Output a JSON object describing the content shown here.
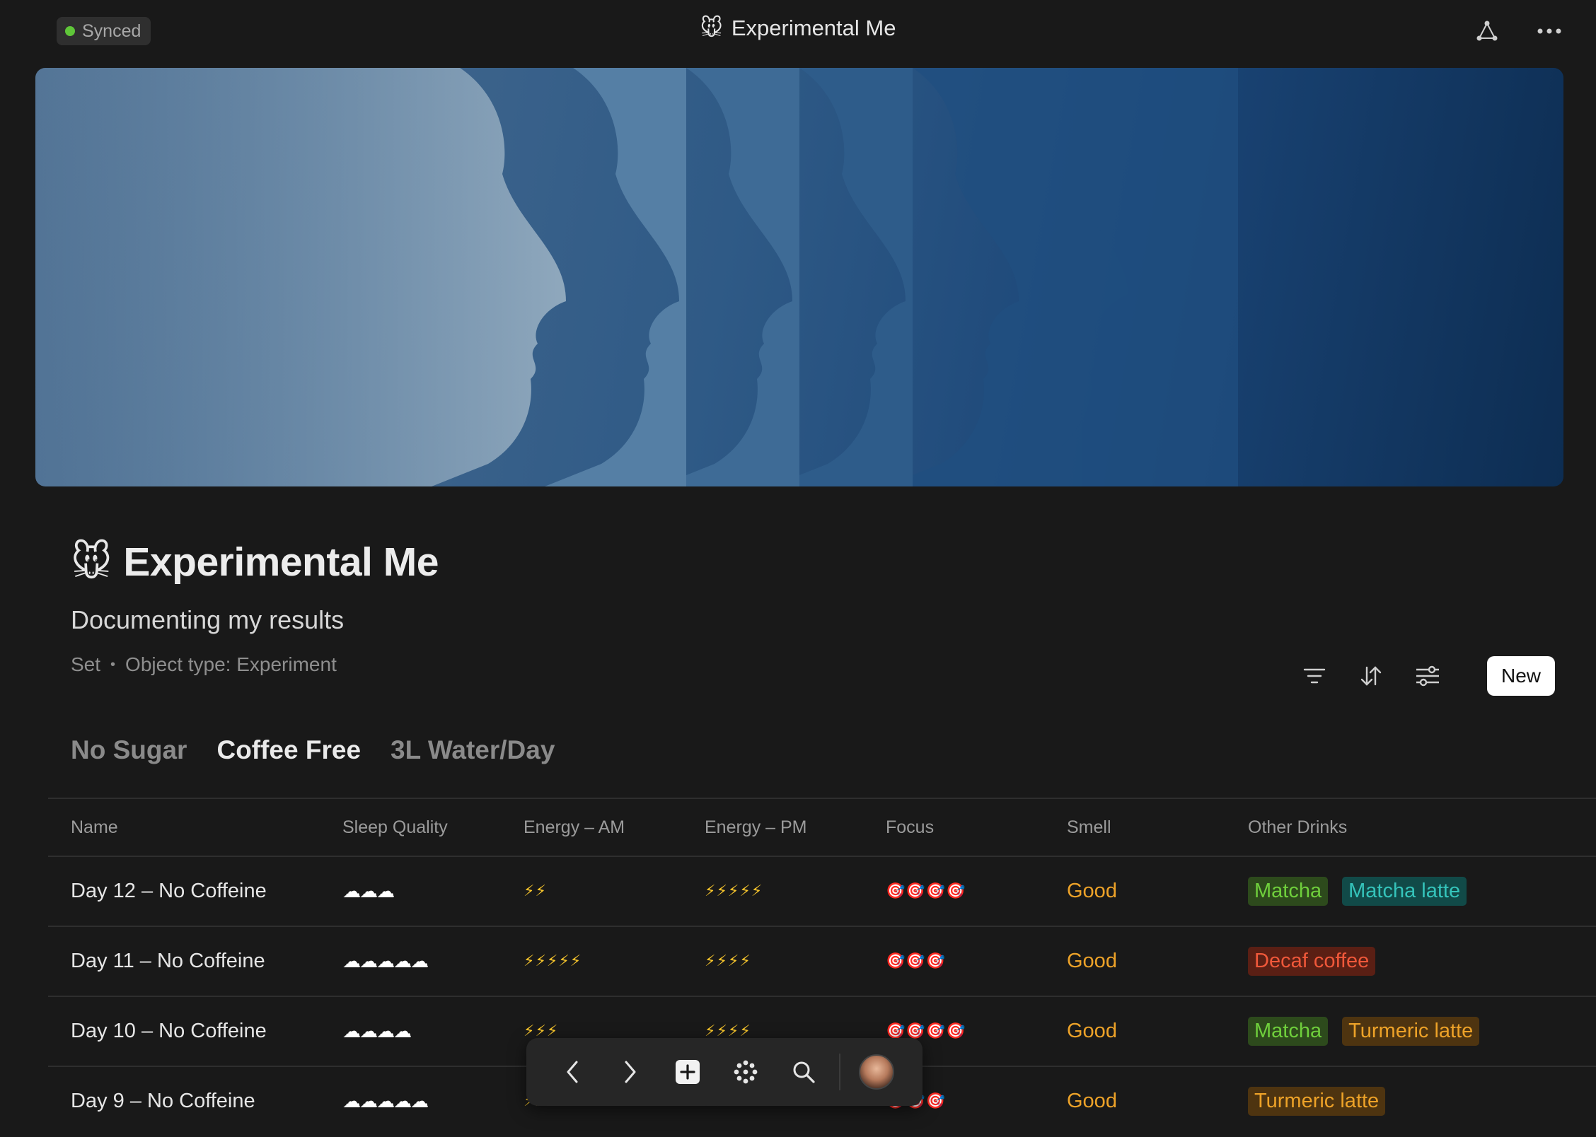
{
  "topbar": {
    "sync_status": "Synced",
    "title_icon": "🐭",
    "title": "Experimental Me",
    "icons": [
      "graph-icon",
      "more-icon"
    ]
  },
  "page": {
    "icon": "🐭",
    "title": "Experimental Me",
    "subtitle": "Documenting my results",
    "meta_kind": "Set",
    "meta_type": "Object type: Experiment",
    "new_button": "New"
  },
  "tabs": [
    {
      "label": "No Sugar",
      "active": false
    },
    {
      "label": "Coffee Free",
      "active": true
    },
    {
      "label": "3L Water/Day",
      "active": false
    }
  ],
  "table": {
    "columns": [
      "Name",
      "Sleep Quality",
      "Energy – AM",
      "Energy – PM",
      "Focus",
      "Smell",
      "Other Drinks"
    ],
    "rows": [
      {
        "name": "Day 12 – No Coffeine",
        "sleep": "☁☁☁",
        "energy_am": "⚡⚡",
        "energy_pm": "⚡⚡⚡⚡⚡",
        "focus": "🎯🎯🎯🎯",
        "smell": "Good",
        "drinks": [
          {
            "label": "Matcha",
            "bg": "#2d4a1c",
            "fg": "#6fcf3c"
          },
          {
            "label": "Matcha latte",
            "bg": "#114a48",
            "fg": "#35c4bb"
          }
        ]
      },
      {
        "name": "Day 11 – No Coffeine",
        "sleep": "☁☁☁☁☁",
        "energy_am": "⚡⚡⚡⚡⚡",
        "energy_pm": "⚡⚡⚡⚡",
        "focus": "🎯🎯🎯",
        "smell": "Good",
        "drinks": [
          {
            "label": "Decaf coffee",
            "bg": "#5a1f14",
            "fg": "#f0583a"
          }
        ]
      },
      {
        "name": "Day 10 – No Coffeine",
        "sleep": "☁☁☁☁",
        "energy_am": "⚡⚡⚡",
        "energy_pm": "⚡⚡⚡⚡",
        "focus": "🎯🎯🎯🎯",
        "smell": "Good",
        "drinks": [
          {
            "label": "Matcha",
            "bg": "#2d4a1c",
            "fg": "#6fcf3c"
          },
          {
            "label": "Turmeric latte",
            "bg": "#4e3410",
            "fg": "#eda228"
          }
        ]
      },
      {
        "name": "Day 9 – No Coffeine",
        "sleep": "☁☁☁☁☁",
        "energy_am": "⚡⚡⚡",
        "energy_pm": "⚡⚡⚡⚡",
        "focus": "🎯🎯🎯",
        "smell": "Good",
        "drinks": [
          {
            "label": "Turmeric latte",
            "bg": "#4e3410",
            "fg": "#eda228"
          }
        ]
      }
    ]
  },
  "floatnav": {
    "icons": [
      "back-icon",
      "forward-icon",
      "plus-icon",
      "graph-dots-icon",
      "search-icon",
      "avatar"
    ]
  },
  "colors": {
    "background": "#191919",
    "synced_dot": "#5fc639",
    "smell_text": "#eda228"
  }
}
